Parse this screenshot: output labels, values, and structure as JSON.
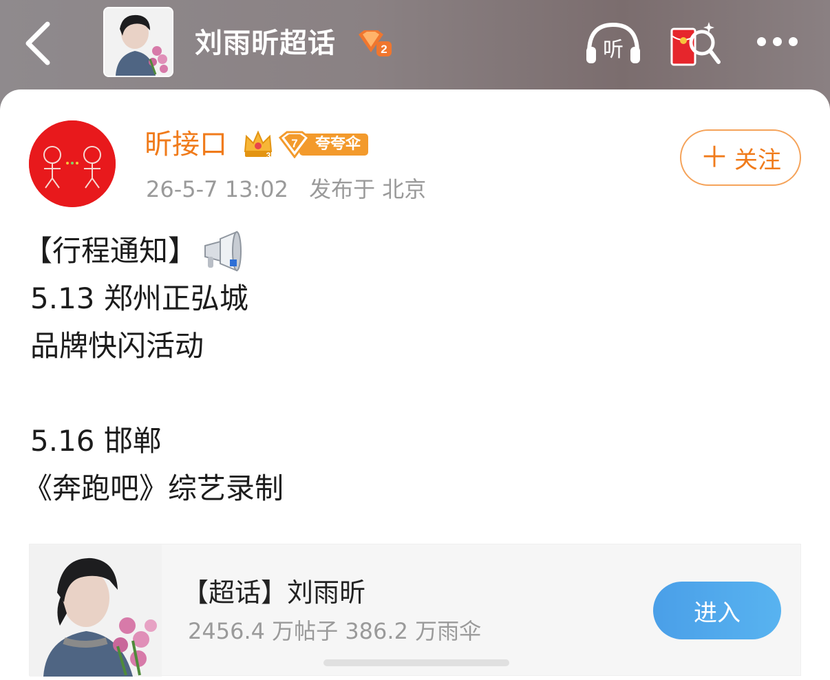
{
  "header": {
    "topic_title": "刘雨昕超话",
    "topic_badge_level": "2",
    "listen_label": "听",
    "icons": {
      "back": "back-chevron-icon",
      "listen": "headphones-icon",
      "redpack": "red-envelope-search-icon",
      "more": "more-dots-icon"
    }
  },
  "post": {
    "username": "昕接口",
    "crown_level": "3",
    "fan_badge_level": "7",
    "fan_badge_label": "夸夸伞",
    "timestamp": "26-5-7 13:02",
    "location": "发布于 北京",
    "follow_label": "关注",
    "follow_plus": "＋",
    "lines": [
      "【行程通知】",
      "5.13 郑州正弘城",
      "品牌快闪活动",
      "",
      "5.16 邯郸",
      "《奔跑吧》综艺录制"
    ]
  },
  "topic_card": {
    "title": "【超话】刘雨昕",
    "stats": "2456.4 万帖子  386.2 万雨伞",
    "enter_label": "进入"
  },
  "colors": {
    "accent_orange": "#f07b1b",
    "enter_blue": "#4a9fe8",
    "avatar_red": "#e8191c"
  }
}
